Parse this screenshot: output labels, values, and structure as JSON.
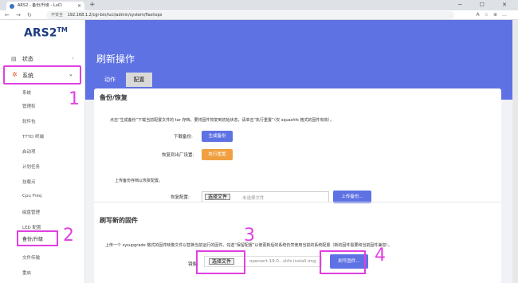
{
  "browser": {
    "tab_title": "ARS2 - 备份/升级 - LuCI",
    "new_tab": "+",
    "window_controls": "─ ☐ ✕",
    "secure_label": "不安全",
    "url": "192.168.1.2/cgi-bin/luci/admin/system/flashops",
    "toolbar_icons": "A☆⊕…"
  },
  "sidebar": {
    "brand": "ARS2",
    "brand_tm": "TM",
    "status_label": "状态",
    "system_label": "系统",
    "sub_items": [
      "系统",
      "管理权",
      "软件包",
      "TTYD 终端",
      "启动项",
      "计划任务",
      "挂载点",
      "Cpu Freq",
      "磁盘管理",
      "LED 配置"
    ],
    "upgrade_item": "备份/升级",
    "after_items": [
      "文件传输",
      "重启"
    ]
  },
  "main": {
    "title": "刷新操作",
    "tabs": {
      "actions": "动作",
      "config": "配置"
    },
    "backup": {
      "title": "备份/恢复",
      "desc": "点击“生成备份”下载当前配置文件的 tar 存档。要将固件恢复到初始状态，请单击“执行重置”（仅 squashfs 格式的固件有效）。",
      "download_label": "下载备份:",
      "generate_btn": "生成备份",
      "reset_label": "恢复到出厂设置:",
      "reset_btn": "执行重置",
      "upload_desc": "上传备份存档以恢复配置。",
      "restore_label": "恢复配置:",
      "choose_file": "选择文件",
      "no_file": "未选择文件",
      "upload_btn": "上传备份..."
    },
    "flash": {
      "title": "刷写新的固件",
      "desc": "上传一个 sysupgrade 格式的固件映像文件以替换当前运行的固件。勾选“保留配置”以使更新后的系统仍然使用当前的系统配置（新的固件需要和当前固件兼容）。",
      "image_label": "镜像:",
      "choose_file": "选择文件",
      "file_name": "openwrt-19.0...shfs.install.img",
      "flash_btn": "刷写固件..."
    }
  },
  "annotations": [
    "1",
    "2",
    "3",
    "4"
  ],
  "colors": {
    "accent": "#5e72e4",
    "annotation": "#e040e0",
    "reset": "#f0a040",
    "brand": "#1f3c80"
  }
}
